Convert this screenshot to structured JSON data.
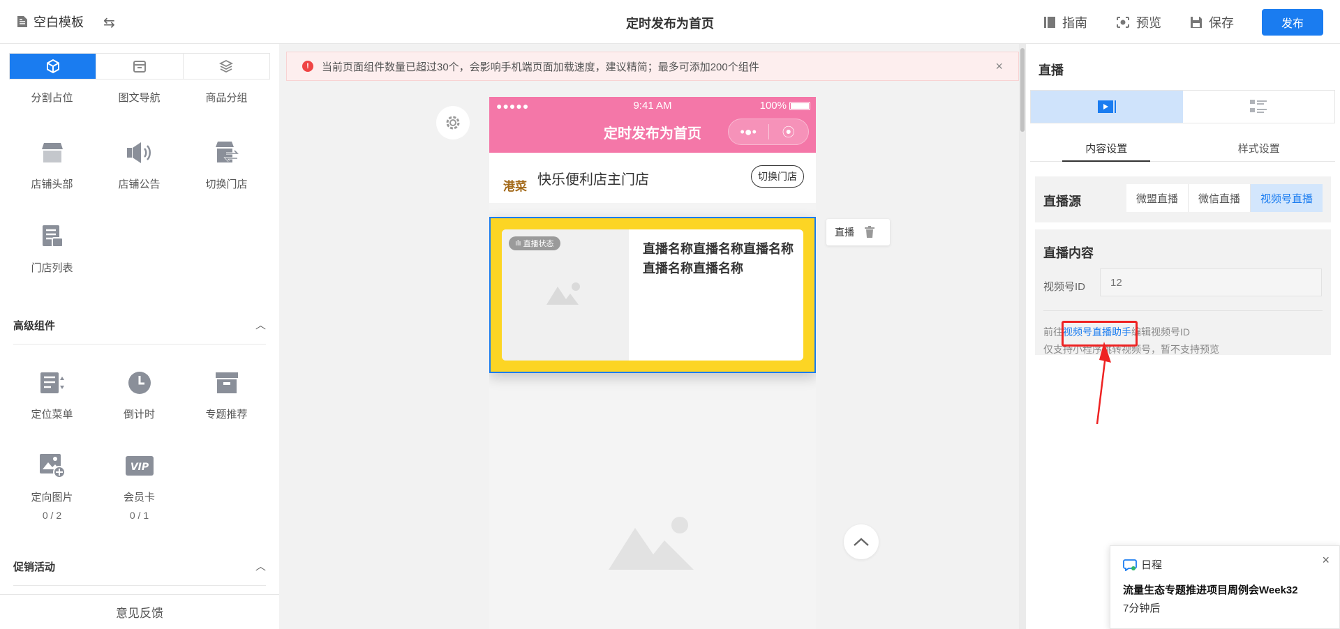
{
  "header": {
    "template_label": "空白模板",
    "page_title": "定时发布为首页",
    "guide_label": "指南",
    "preview_label": "预览",
    "save_label": "保存",
    "publish_label": "发布"
  },
  "sidebar": {
    "basic_items": [
      {
        "label": "分割占位",
        "icon": "divider-icon"
      },
      {
        "label": "图文导航",
        "icon": "image-nav-icon"
      },
      {
        "label": "商品分组",
        "icon": "product-group-icon"
      },
      {
        "label": "店铺头部",
        "icon": "store-header-icon"
      },
      {
        "label": "店铺公告",
        "icon": "announcement-icon"
      },
      {
        "label": "切换门店",
        "icon": "switch-store-icon"
      },
      {
        "label": "门店列表",
        "icon": "store-list-icon"
      }
    ],
    "advanced_title": "高级组件",
    "advanced_items": [
      {
        "label": "定位菜单",
        "icon": "location-menu-icon"
      },
      {
        "label": "倒计时",
        "icon": "clock-icon"
      },
      {
        "label": "专题推荐",
        "icon": "topic-icon"
      },
      {
        "label": "定向图片",
        "icon": "directed-image-icon",
        "count": "0 / 2"
      },
      {
        "label": "会员卡",
        "icon": "vip-card-icon",
        "count": "0 / 1"
      }
    ],
    "promo_title": "促销活动",
    "feedback_label": "意见反馈"
  },
  "alert": {
    "text": "当前页面组件数量已超过30个，会影响手机端页面加载速度，建议精简；最多可添加200个组件"
  },
  "phone": {
    "status_signal": "●●●●●",
    "status_time": "9:41 AM",
    "status_battery": "100%",
    "page_title": "定时发布为首页",
    "store_logo": "港菜",
    "store_name": "快乐便利店主门店",
    "switch_store_label": "切换门店",
    "live_badge": "直播状态",
    "live_title": "直播名称直播名称直播名称直播名称直播名称"
  },
  "float_tool": {
    "label": "直播"
  },
  "panel": {
    "title": "直播",
    "tabs": [
      "内容设置",
      "样式设置"
    ],
    "source_label": "直播源",
    "source_options": [
      "微盟直播",
      "微信直播",
      "视频号直播"
    ],
    "selected_source": "视频号直播",
    "content_label": "直播内容",
    "field_label": "视频号ID",
    "field_placeholder": "12",
    "note_prefix": "前往",
    "note_link": "视频号直播助手",
    "note_suffix": "编辑视频号ID",
    "note_line2": "仅支持小程序跳转视频号，暂不支持预览"
  },
  "notification": {
    "app": "日程",
    "title": "流量生态专题推进项目周例会Week32",
    "time": "7分钟后"
  },
  "colors": {
    "primary": "#1a7cf0",
    "phone_header": "#f477a8",
    "live_bg": "#fcd524",
    "alert_bg": "#fdeeee",
    "highlight": "#ee2222"
  }
}
